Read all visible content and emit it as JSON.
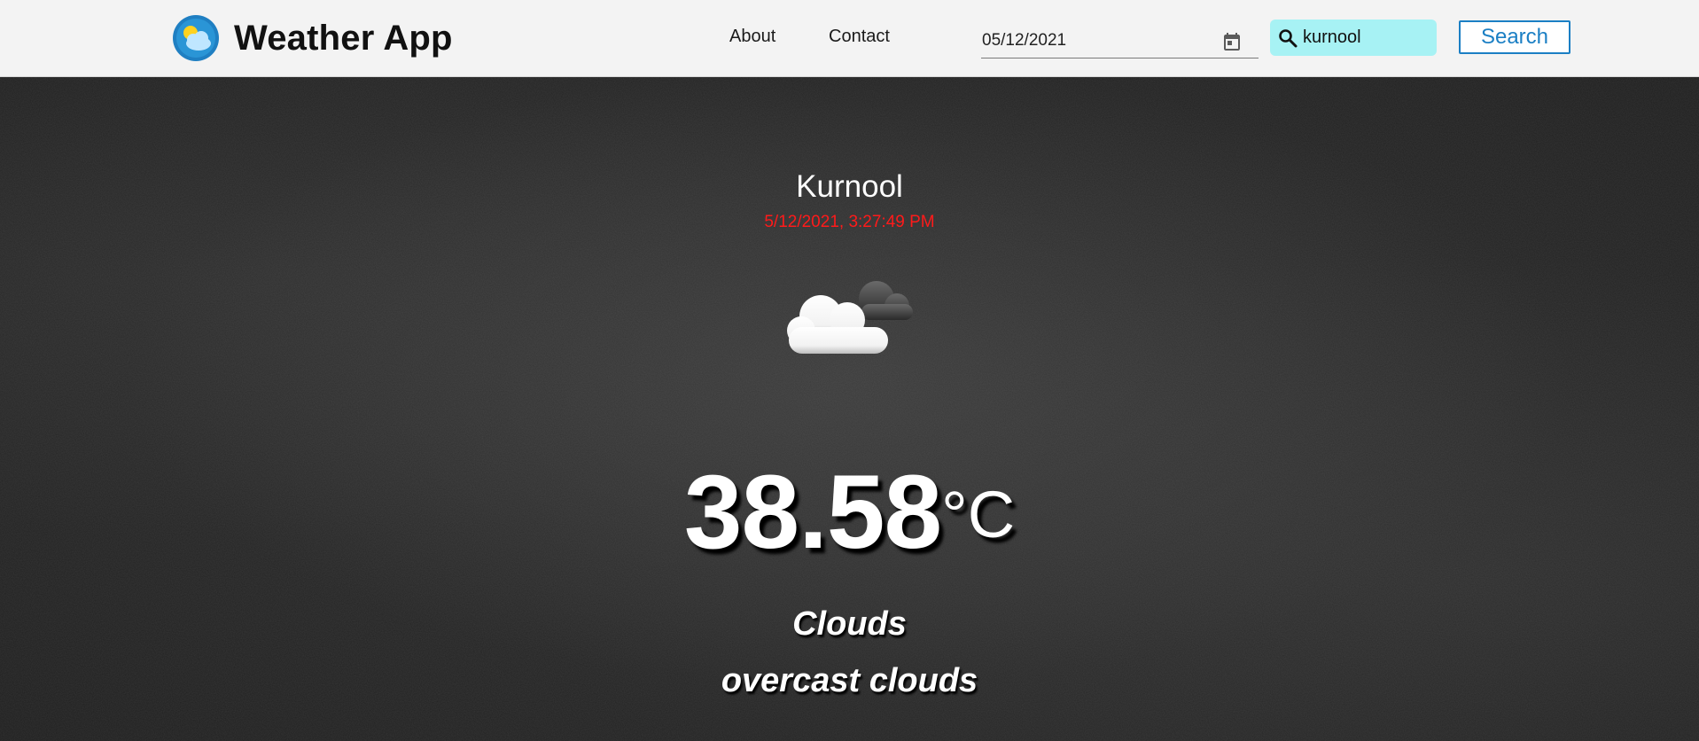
{
  "header": {
    "app_title": "Weather App",
    "logo_icon": "weather-logo-icon",
    "nav": [
      {
        "label": "About"
      },
      {
        "label": "Contact"
      }
    ],
    "date_input": {
      "value": "05/12/2021",
      "icon": "calendar-icon"
    },
    "search": {
      "value": "kurnool",
      "icon": "search-icon"
    },
    "search_button_label": "Search",
    "colors": {
      "navbar_bg": "#f3f3f3",
      "search_bg": "#a7f2f4",
      "button_accent": "#1b7fc4"
    }
  },
  "weather": {
    "city": "Kurnool",
    "timestamp": "5/12/2021, 3:27:49 PM",
    "icon": "partly-cloudy-icon",
    "temperature": "38.58",
    "unit": "°C",
    "condition": "Clouds",
    "description": "overcast clouds",
    "colors": {
      "timestamp": "#ff1a1a",
      "text": "#ffffff"
    }
  }
}
